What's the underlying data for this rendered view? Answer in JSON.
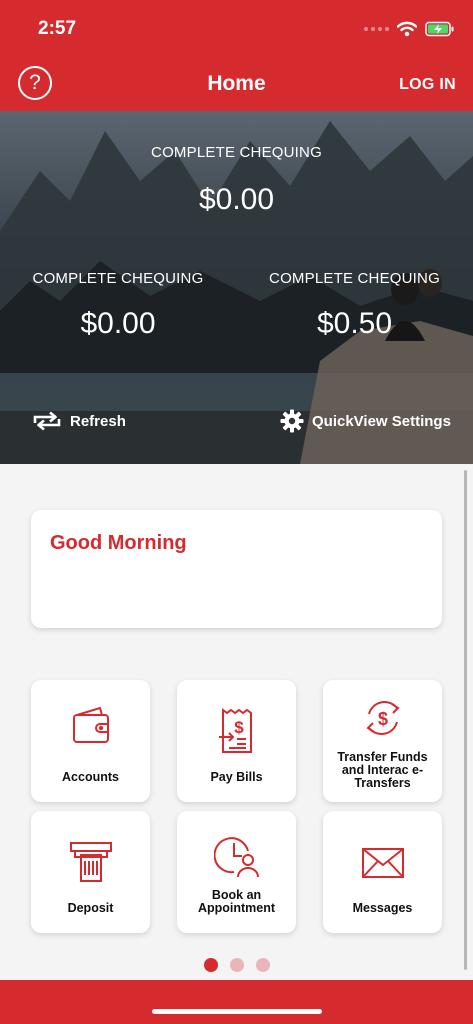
{
  "status": {
    "time": "2:57"
  },
  "nav": {
    "title": "Home",
    "help_symbol": "?",
    "login_label": "LOG IN"
  },
  "quickview": {
    "primary": {
      "label": "COMPLETE CHEQUING",
      "amount": "$0.00"
    },
    "accounts": [
      {
        "label": "COMPLETE CHEQUING",
        "amount": "$0.00"
      },
      {
        "label": "COMPLETE CHEQUING",
        "amount": "$0.50"
      }
    ],
    "refresh_label": "Refresh",
    "settings_label": "QuickView Settings"
  },
  "greeting": {
    "text": "Good Morning"
  },
  "tiles": [
    {
      "label": "Accounts",
      "icon": "wallet-icon"
    },
    {
      "label": "Pay Bills",
      "icon": "receipt-dollar-icon"
    },
    {
      "label": "Transfer Funds and Interac e-Transfers",
      "icon": "transfer-dollar-icon"
    },
    {
      "label": "Deposit",
      "icon": "atm-deposit-icon"
    },
    {
      "label": "Book an Appointment",
      "icon": "clock-person-icon"
    },
    {
      "label": "Messages",
      "icon": "envelope-icon"
    }
  ],
  "pagination": {
    "current": 1,
    "total": 3
  },
  "colors": {
    "brand_red": "#d52b2f",
    "background": "#f4f4f4",
    "dot_inactive": "#e8b6b8"
  }
}
